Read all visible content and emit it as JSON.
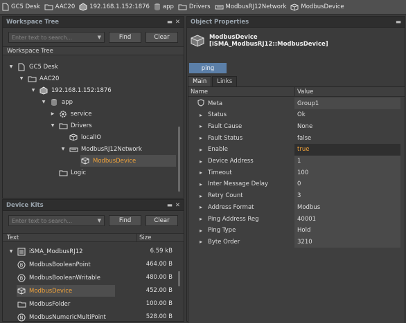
{
  "breadcrumb": [
    {
      "label": "GC5 Desk",
      "icon": "page-icon"
    },
    {
      "label": "AAC20",
      "icon": "folder-icon"
    },
    {
      "label": "192.168.1.152:1876",
      "icon": "station-icon"
    },
    {
      "label": "app",
      "icon": "database-icon"
    },
    {
      "label": "Drivers",
      "icon": "folder-icon"
    },
    {
      "label": "ModbusRJ12Network",
      "icon": "network-icon"
    },
    {
      "label": "ModbusDevice",
      "icon": "device-icon"
    }
  ],
  "workspace": {
    "title": "Workspace Tree",
    "search_placeholder": "Enter text to search...",
    "find_label": "Find",
    "clear_label": "Clear",
    "column": "Workspace Tree",
    "items": [
      {
        "label": "GC5 Desk",
        "icon": "page-icon",
        "expanded": true
      },
      {
        "label": "AAC20",
        "icon": "folder-icon",
        "expanded": true
      },
      {
        "label": "192.168.1.152:1876",
        "icon": "station-icon",
        "expanded": true
      },
      {
        "label": "app",
        "icon": "database-icon",
        "expanded": true
      },
      {
        "label": "service",
        "icon": "gear-icon",
        "expanded": false
      },
      {
        "label": "Drivers",
        "icon": "folder-icon",
        "expanded": true
      },
      {
        "label": "localIO",
        "icon": "device-icon",
        "expanded": null
      },
      {
        "label": "ModbusRJ12Network",
        "icon": "network-icon",
        "expanded": true
      },
      {
        "label": "ModbusDevice",
        "icon": "device-icon",
        "expanded": null,
        "selected": true
      },
      {
        "label": "Logic",
        "icon": "folder-icon",
        "expanded": null
      }
    ]
  },
  "kits": {
    "title": "Device Kits",
    "search_placeholder": "Enter text to search...",
    "find_label": "Find",
    "clear_label": "Clear",
    "col_text": "Text",
    "col_size": "Size",
    "items": [
      {
        "label": "iSMA_ModbusRJ12",
        "size": "6.59 kB",
        "icon": "kit-icon",
        "expanded": true
      },
      {
        "label": "ModbusBooleanPoint",
        "size": "464.00 B",
        "icon": "boolean-point-icon"
      },
      {
        "label": "ModbusBooleanWritable",
        "size": "480.00 B",
        "icon": "boolean-writable-icon"
      },
      {
        "label": "ModbusDevice",
        "size": "452.00 B",
        "icon": "device-icon",
        "selected": true
      },
      {
        "label": "ModbusFolder",
        "size": "100.00 B",
        "icon": "folder-icon"
      },
      {
        "label": "ModbusNumericMultiPoint",
        "size": "528.00 B",
        "icon": "numeric-multipoint-icon"
      }
    ]
  },
  "object": {
    "title": "Object Properties",
    "name": "ModbusDevice",
    "type": "[iSMA_ModbusRJ12::ModbusDevice]",
    "ping_label": "ping",
    "tabs": [
      "Main",
      "Links"
    ],
    "col_name": "Name",
    "col_value": "Value",
    "properties": [
      {
        "name": "Meta",
        "value": "Group1",
        "icon": "shield-icon",
        "editable": true
      },
      {
        "name": "Status",
        "value": "Ok",
        "icon": "dot-icon",
        "editable": false
      },
      {
        "name": "Fault Cause",
        "value": "None",
        "icon": "dot-icon",
        "editable": false
      },
      {
        "name": "Fault Status",
        "value": "false",
        "icon": "dot-icon",
        "editable": false
      },
      {
        "name": "Enable",
        "value": "true",
        "icon": "dot-icon",
        "editable": true,
        "focused": true
      },
      {
        "name": "Device Address",
        "value": "1",
        "icon": "dot-icon",
        "editable": true
      },
      {
        "name": "Timeout",
        "value": "100",
        "icon": "dot-icon",
        "editable": true
      },
      {
        "name": "Inter Message Delay",
        "value": "0",
        "icon": "dot-icon",
        "editable": true
      },
      {
        "name": "Retry Count",
        "value": "3",
        "icon": "dot-icon",
        "editable": true
      },
      {
        "name": "Address Format",
        "value": "Modbus",
        "icon": "dot-icon",
        "editable": true
      },
      {
        "name": "Ping Address Reg",
        "value": "40001",
        "icon": "dot-icon",
        "editable": true
      },
      {
        "name": "Ping Type",
        "value": "Hold",
        "icon": "dot-icon",
        "editable": true
      },
      {
        "name": "Byte Order",
        "value": "3210",
        "icon": "dot-icon",
        "editable": true
      }
    ]
  },
  "colors": {
    "accent": "#5b7fa8",
    "selected_text": "#f0a23a"
  }
}
